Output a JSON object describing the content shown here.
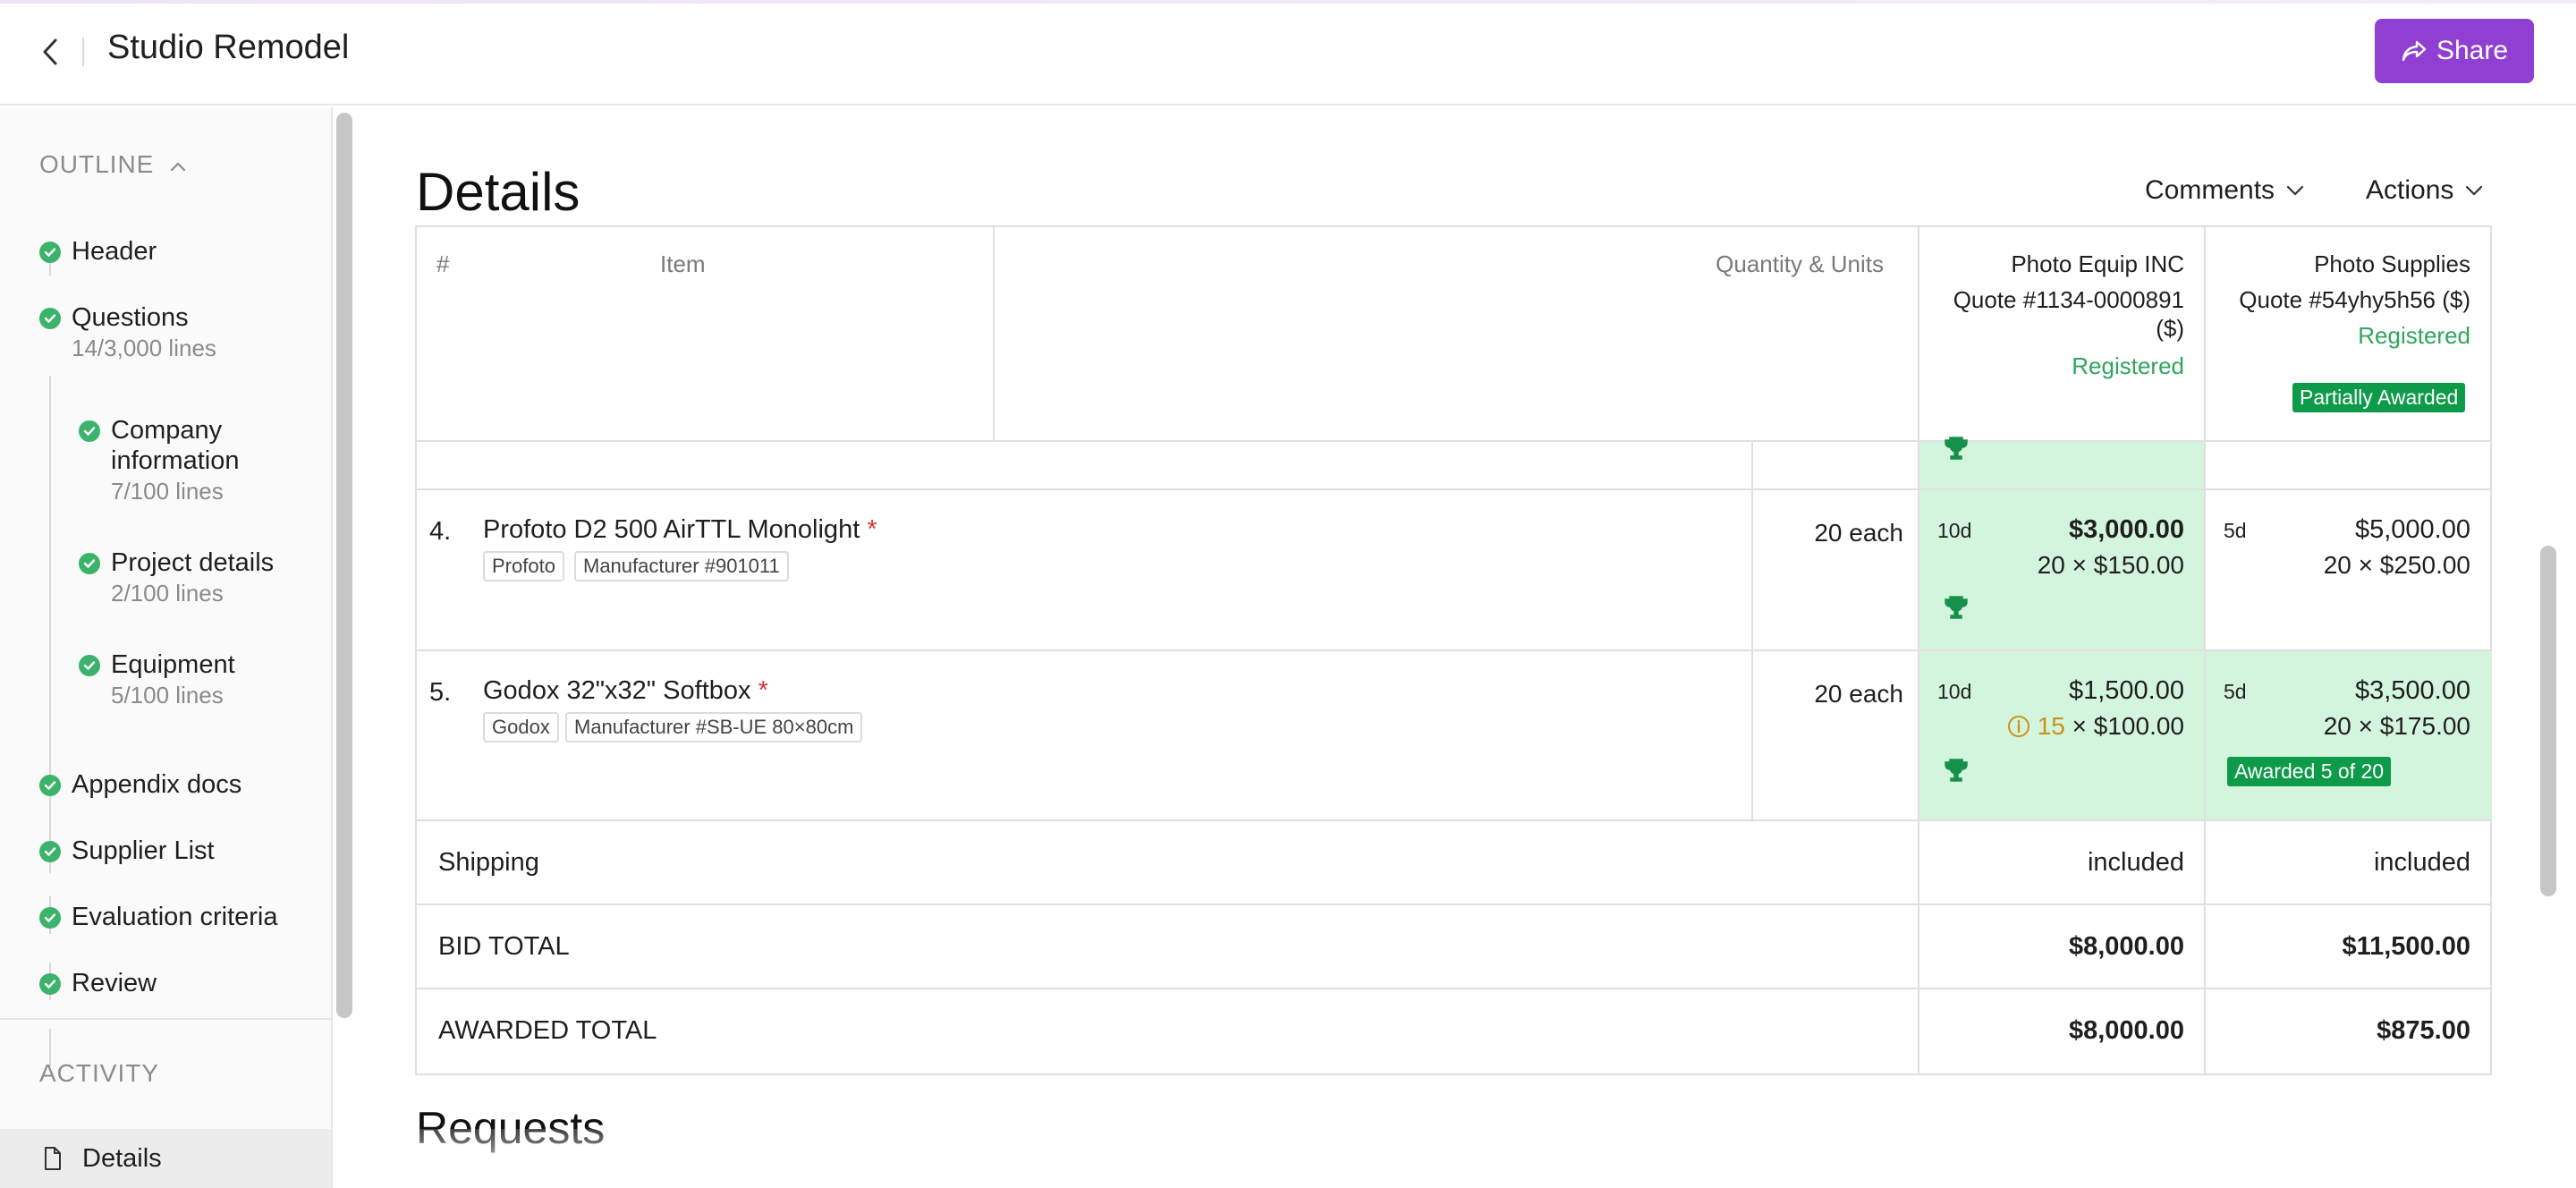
{
  "header": {
    "title": "Studio Remodel",
    "share_label": "Share"
  },
  "sidebar": {
    "outline_label": "OUTLINE",
    "items": [
      {
        "label": "Header",
        "sub": ""
      },
      {
        "label": "Questions",
        "sub": "14/3,000 lines"
      },
      {
        "label": "Company information",
        "sub": "7/100 lines"
      },
      {
        "label": "Project details",
        "sub": "2/100 lines"
      },
      {
        "label": "Equipment",
        "sub": "5/100 lines"
      },
      {
        "label": "Appendix docs",
        "sub": ""
      },
      {
        "label": "Supplier List",
        "sub": ""
      },
      {
        "label": "Evaluation criteria",
        "sub": ""
      },
      {
        "label": "Review",
        "sub": ""
      }
    ],
    "activity_label": "ACTIVITY",
    "activity_items": [
      {
        "label": "Details"
      }
    ]
  },
  "main": {
    "section_title": "Details",
    "comments_label": "Comments",
    "actions_label": "Actions",
    "next_section_title": "Requests"
  },
  "table": {
    "headers": {
      "num": "#",
      "item": "Item",
      "qty": "Quantity & Units"
    },
    "suppliers": [
      {
        "name": "Photo Equip INC",
        "quote": "Quote #1134-0000891",
        "currency": "($)",
        "status": "Registered",
        "badge": ""
      },
      {
        "name": "Photo Supplies",
        "quote": "Quote #54yhy5h56 ($)",
        "currency": "",
        "status": "Registered",
        "badge": "Partially Awarded"
      }
    ],
    "rows": [
      {
        "num": "4.",
        "name": "Profoto D2 500 AirTTL Monolight",
        "required": "*",
        "tags": [
          "Profoto",
          "Manufacturer #901011"
        ],
        "qty": "20 each",
        "bids": [
          {
            "days": "10d",
            "price": "$3,000.00",
            "calc": "20 × $150.00",
            "warn_qty": "",
            "awarded_label": ""
          },
          {
            "days": "5d",
            "price": "$5,000.00",
            "calc": "20 × $250.00",
            "warn_qty": "",
            "awarded_label": ""
          }
        ]
      },
      {
        "num": "5.",
        "name": "Godox 32\"x32\" Softbox",
        "required": "*",
        "tags": [
          "Godox",
          "Manufacturer #SB-UE 80×80cm"
        ],
        "qty": "20 each",
        "bids": [
          {
            "days": "10d",
            "price": "$1,500.00",
            "calc": " × $100.00",
            "warn_qty": "15",
            "awarded_label": ""
          },
          {
            "days": "5d",
            "price": "$3,500.00",
            "calc": "20 × $175.00",
            "warn_qty": "",
            "awarded_label": "Awarded 5 of 20"
          }
        ]
      }
    ],
    "summary": [
      {
        "label": "Shipping",
        "values": [
          "included",
          "included"
        ]
      },
      {
        "label": "BID TOTAL",
        "values": [
          "$8,000.00",
          "$11,500.00"
        ]
      },
      {
        "label": "AWARDED TOTAL",
        "values": [
          "$8,000.00",
          "$875.00"
        ]
      }
    ]
  },
  "colors": {
    "accent": "#8f3fd1",
    "success": "#3bb36b",
    "award_bg": "#d4f5dd",
    "badge": "#0d9b4a",
    "warning": "#c9921a"
  }
}
